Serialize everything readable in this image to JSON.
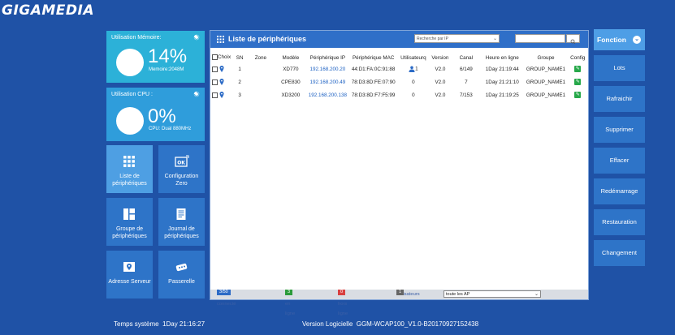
{
  "app": {
    "logo": "GIGAMEDIA"
  },
  "memory": {
    "title": "Utilisation Mémoire:",
    "percent": "14%",
    "detail": "Memoire:2048M"
  },
  "cpu": {
    "title": "Utilisation CPU :",
    "percent": "0%",
    "detail": "CPU: Dual 880MHz"
  },
  "tiles": [
    {
      "label1": "Liste de",
      "label2": "périphériques",
      "icon": "grid-icon"
    },
    {
      "label1": "Configuration",
      "label2": "Zero",
      "icon": "ok-icon"
    },
    {
      "label1": "Groupe de",
      "label2": "périphériques",
      "icon": "layout-icon"
    },
    {
      "label1": "Journal de",
      "label2": "périphériques",
      "icon": "document-icon"
    },
    {
      "label1": "Adresse Serveur",
      "label2": "",
      "icon": "map-pin-icon"
    },
    {
      "label1": "Passerelle",
      "label2": "",
      "icon": "gateway-icon"
    }
  ],
  "panel": {
    "title": "Liste de périphériques",
    "search_select": "Recherche par IP",
    "search_value": ""
  },
  "table": {
    "headers": [
      "Choix",
      "SN",
      "Zone",
      "Modèle",
      "Périphérique IP",
      "Périphérique MAC",
      "Utilisateurq",
      "Version",
      "Canal",
      "Heure en ligne",
      "Groupe",
      "Config"
    ],
    "rows": [
      {
        "sn": "1",
        "zone": "",
        "model": "XD770",
        "ip": "192.168.200.20",
        "mac": "44:D1:FA:0C:91:88",
        "users": "1",
        "version": "V2.0",
        "channel": "6/149",
        "uptime": "1Day 21:19:44",
        "group": "GROUP_NAME1"
      },
      {
        "sn": "2",
        "zone": "",
        "model": "CPE830",
        "ip": "192.168.200.49",
        "mac": "78:D3:8D:FE:07:90",
        "users": "0",
        "version": "V2.0",
        "channel": "7",
        "uptime": "1Day 21:21:10",
        "group": "GROUP_NAME1"
      },
      {
        "sn": "3",
        "zone": "",
        "model": "XD3200",
        "ip": "192.168.200.138",
        "mac": "78:D3:8D:F7:F5:99",
        "users": "0",
        "version": "V2.0",
        "channel": "7/153",
        "uptime": "1Day 21:19:25",
        "group": "GROUP_NAME1"
      }
    ]
  },
  "status": {
    "connected_label": "AP connecté",
    "connected_value": "3/50",
    "online_label": "AP en ligne",
    "online_value": "3",
    "offline_label": "AP hors ligne",
    "offline_value": "0",
    "users_label": "Utilisateurs",
    "users_value": "1",
    "filter_value": "toute les AP"
  },
  "actions": {
    "head": "Fonction",
    "items": [
      "Lots",
      "Rafraichir",
      "Supprimer",
      "Effacer",
      "Redémarrage",
      "Restauration",
      "Changement"
    ]
  },
  "footer": {
    "time_label": "Temps système",
    "time_value": "1Day 21:16:27",
    "version_label": "Version Logicielle",
    "version_value": "GGM-WCAP100_V1.0-B20170927152438"
  },
  "colors": {
    "background": "#1f52a6",
    "accent": "#2e74c8",
    "panel_header": "#2f6fc8"
  }
}
